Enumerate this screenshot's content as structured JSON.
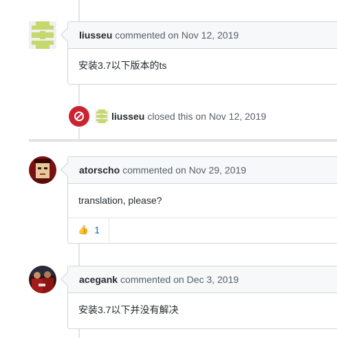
{
  "comments": [
    {
      "author": "liusseu",
      "meta": "commented on Nov 12, 2019",
      "body": "安装3.7以下版本的ts",
      "avatar_icon": "identicon-avatar"
    },
    {
      "author": "atorscho",
      "meta": "commented on Nov 29, 2019",
      "body": "translation, please?",
      "avatar_icon": "pixel-face-avatar",
      "reaction": {
        "emoji": "👍",
        "count": "1"
      }
    },
    {
      "author": "acegank",
      "meta": "commented on Dec 3, 2019",
      "body": "安装3.7以下并没有解决",
      "avatar_icon": "photo-avatar"
    }
  ],
  "close_event": {
    "author": "liusseu",
    "meta": "closed this on Nov 12, 2019",
    "icon": "circle-slash-icon"
  },
  "colors": {
    "identicon": "#c5d86d",
    "closed_badge": "#cb2431",
    "link": "#0366d6",
    "header_bg": "#f6f8fa"
  }
}
